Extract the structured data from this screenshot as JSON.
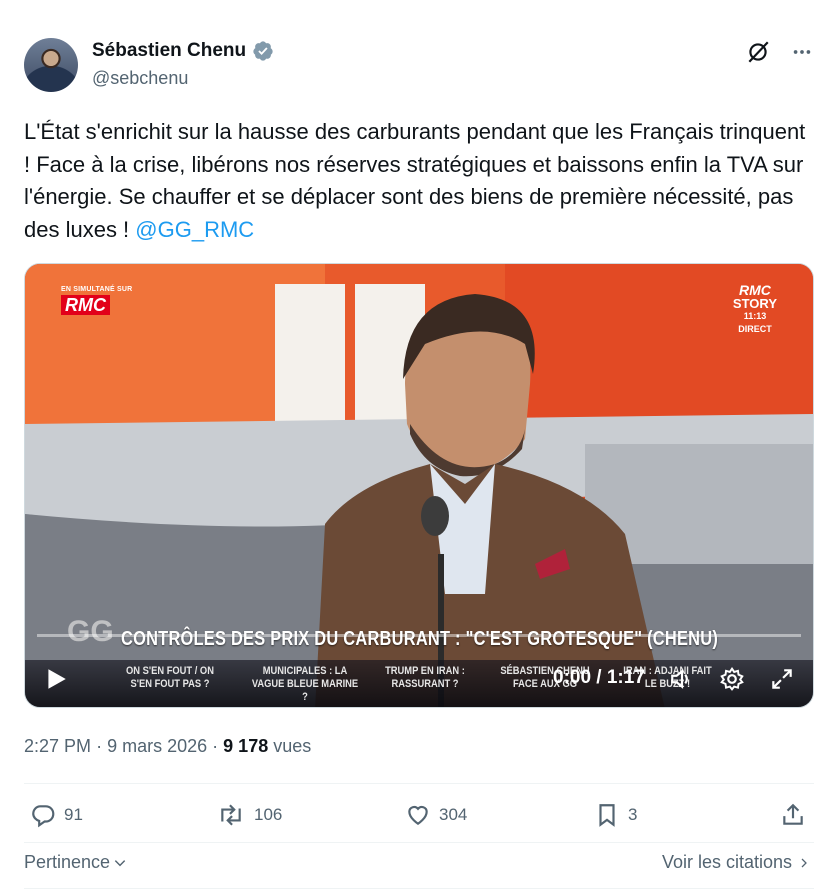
{
  "author": {
    "name": "Sébastien Chenu",
    "handle": "@sebchenu"
  },
  "tweet": {
    "text": "L'État s'enrichit sur la hausse des carburants pendant que les Français trinquent ! Face à la crise, libérons nos réserves stratégiques et baissons enfin la TVA sur l'énergie. Se chauffer et se déplacer sont des biens de première nécessité, pas des luxes ! ",
    "mention": "@GG_RMC"
  },
  "video": {
    "badge_small": "EN SIMULTANÉ SUR",
    "badge_logo": "RMC",
    "channel_l1": "RMC",
    "channel_l2": "STORY",
    "channel_time": "11:13",
    "channel_direct": "DIRECT",
    "show_logo": "GG",
    "headline": "CONTRÔLES DES PRIX DU CARBURANT : \"C'EST GROTESQUE\" (CHENU)",
    "ticker": [
      "ON S'EN FOUT / ON S'EN FOUT PAS ?",
      "MUNICIPALES : LA VAGUE BLEUE MARINE ?",
      "TRUMP EN IRAN : RASSURANT ?",
      "SÉBASTIEN CHENU FACE AUX GG",
      "IRAN : ADJANI FAIT LE BUZZ !"
    ],
    "time": "0:00 / 1:17",
    "progress": 0
  },
  "meta": {
    "time": "2:27 PM",
    "sep": "·",
    "date": "9 mars 2026",
    "views_count": "9 178",
    "views_label": "vues"
  },
  "actions": {
    "replies": "91",
    "reposts": "106",
    "likes": "304",
    "bookmarks": "3"
  },
  "footer": {
    "sort_label": "Pertinence",
    "quotes_link": "Voir les citations"
  },
  "colors": {
    "accent": "#1d9bf0",
    "muted": "#536471",
    "text": "#0f1419",
    "rmc_red": "#e2001a"
  }
}
